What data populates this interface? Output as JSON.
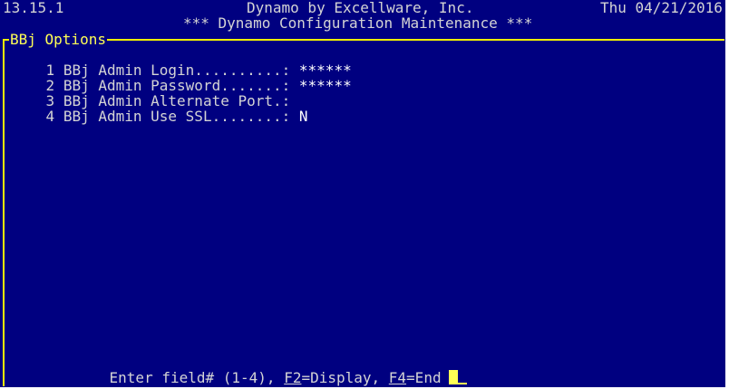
{
  "header": {
    "version": "13.15.1",
    "company": "Dynamo by Excellware, Inc.",
    "date": "Thu 04/21/2016",
    "title": "*** Dynamo Configuration Maintenance ***"
  },
  "section": {
    "label": "BBj Options"
  },
  "fields": [
    {
      "number": "1",
      "label": "BBj Admin Login..........:",
      "value": "******"
    },
    {
      "number": "2",
      "label": "BBj Admin Password.......:",
      "value": "******"
    },
    {
      "number": "3",
      "label": "BBj Admin Alternate Port.:",
      "value": ""
    },
    {
      "number": "4",
      "label": "BBj Admin Use SSL........:",
      "value": "N"
    }
  ],
  "prompt": {
    "text": "Enter field# (1-4), ",
    "f2_key": "F2",
    "f2_action": "=Display, ",
    "f4_key": "F4",
    "f4_action": "=End"
  },
  "colors": {
    "background": "#000080",
    "text": "#d4d4d4",
    "highlight": "#ffff55"
  }
}
